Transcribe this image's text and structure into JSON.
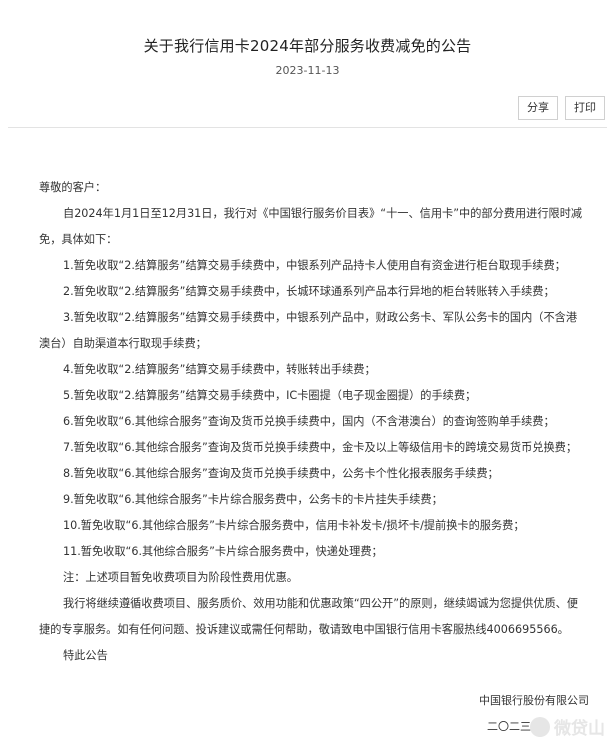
{
  "article": {
    "title": "关于我行信用卡2024年部分服务收费减免的公告",
    "date": "2023-11-13"
  },
  "toolbar": {
    "share_label": "分享",
    "print_label": "打印"
  },
  "body": {
    "salutation": "尊敬的客户：",
    "intro": "自2024年1月1日至12月31日，我行对《中国银行服务价目表》“十一、信用卡”中的部分费用进行限时减免，具体如下：",
    "items": [
      "1.暂免收取“2.结算服务”结算交易手续费中，中银系列产品持卡人使用自有资金进行柜台取现手续费；",
      "2.暂免收取“2.结算服务”结算交易手续费中，长城环球通系列产品本行异地的柜台转账转入手续费；",
      "3.暂免收取“2.结算服务”结算交易手续费中，中银系列产品中，财政公务卡、军队公务卡的国内（不含港澳台）自助渠道本行取现手续费；",
      "4.暂免收取“2.结算服务”结算交易手续费中，转账转出手续费；",
      "5.暂免收取“2.结算服务”结算交易手续费中，IC卡圈提（电子现金圈提）的手续费；",
      "6.暂免收取“6.其他综合服务”查询及货币兑换手续费中，国内（不含港澳台）的查询签购单手续费；",
      "7.暂免收取“6.其他综合服务”查询及货币兑换手续费中，金卡及以上等级信用卡的跨境交易货币兑换费；",
      "8.暂免收取“6.其他综合服务”查询及货币兑换手续费中，公务卡个性化报表服务手续费；",
      "9.暂免收取“6.其他综合服务”卡片综合服务费中，公务卡的卡片挂失手续费；",
      "10.暂免收取“6.其他综合服务”卡片综合服务费中，信用卡补发卡/损坏卡/提前换卡的服务费；",
      "11.暂免收取“6.其他综合服务”卡片综合服务费中，快递处理费；"
    ],
    "note": "注：上述项目暂免收费项目为阶段性费用优惠。",
    "closing": "我行将继续遵循收费项目、服务质价、效用功能和优惠政策“四公开”的原则，继续竭诚为您提供优质、便捷的专享服务。如有任何问题、投诉建议或需任何帮助，敬请致电中国银行信用卡客服热线4006695566。",
    "sign_off": "特此公告"
  },
  "footer": {
    "organization": "中国银行股份有限公司",
    "date_partial": "二〇二三"
  },
  "watermark": {
    "text": "微贷山"
  }
}
